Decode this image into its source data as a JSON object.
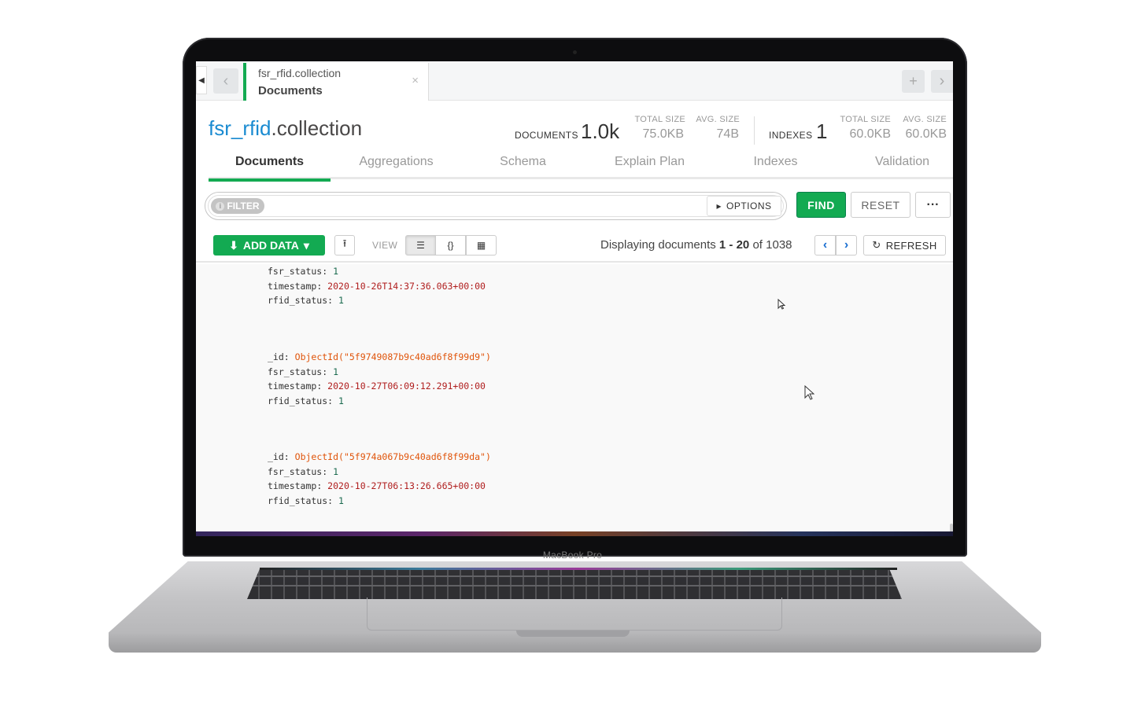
{
  "device": {
    "label": "MacBook Pro"
  },
  "tabbar": {
    "active_tab": {
      "namespace": "fsr_rfid.collection",
      "subtitle": "Documents"
    },
    "close_glyph": "×",
    "plus_glyph": "+"
  },
  "header": {
    "db": "fsr_rfid",
    "collection_suffix": ".collection",
    "documents_label": "DOCUMENTS",
    "documents_value": "1.0k",
    "doc_total_size_label": "TOTAL SIZE",
    "doc_total_size": "75.0KB",
    "doc_avg_size_label": "AVG. SIZE",
    "doc_avg_size": "74B",
    "indexes_label": "INDEXES",
    "indexes_value": "1",
    "idx_total_size_label": "TOTAL SIZE",
    "idx_total_size": "60.0KB",
    "idx_avg_size_label": "AVG. SIZE",
    "idx_avg_size": "60.0KB"
  },
  "subtabs": [
    "Documents",
    "Aggregations",
    "Schema",
    "Explain Plan",
    "Indexes",
    "Validation"
  ],
  "query": {
    "filter_label": "FILTER",
    "options_label": "OPTIONS",
    "find_label": "FIND",
    "reset_label": "RESET",
    "more_label": "···"
  },
  "toolbar": {
    "add_data_label": "ADD DATA",
    "view_label": "VIEW",
    "display_prefix": "Displaying documents ",
    "range": "1 - 20",
    "of_text": " of ",
    "total": "1038",
    "refresh_label": "REFRESH"
  },
  "documents": [
    {
      "fsr_status": "1",
      "timestamp": "2020-10-26T14:37:36.063+00:00",
      "rfid_status": "1"
    },
    {
      "_id": "ObjectId(\"5f9749087b9c40ad6f8f99d9\")",
      "fsr_status": "1",
      "timestamp": "2020-10-27T06:09:12.291+00:00",
      "rfid_status": "1"
    },
    {
      "_id": "ObjectId(\"5f974a067b9c40ad6f8f99da\")",
      "fsr_status": "1",
      "timestamp": "2020-10-27T06:13:26.665+00:00",
      "rfid_status": "1"
    }
  ],
  "field_names": {
    "id": "_id",
    "fsr": "fsr_status",
    "ts": "timestamp",
    "rfid": "rfid_status"
  },
  "colors": {
    "accent": "#13aa52",
    "link": "#1a8bd1",
    "oid": "#e0540a",
    "date": "#b01e1e",
    "number": "#1b6b4f"
  }
}
